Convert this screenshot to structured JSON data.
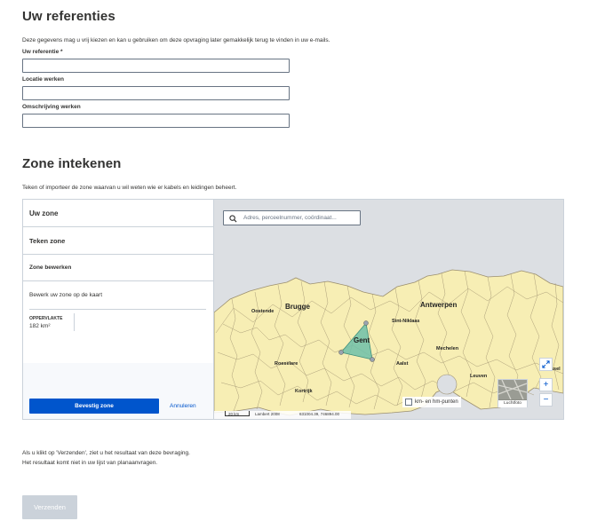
{
  "references": {
    "title": "Uw referenties",
    "intro": "Deze gegevens mag u vrij kiezen en kan u gebruiken om deze opvraging later gemakkelijk terug te vinden in uw e-mails.",
    "reference_label": "Uw referentie *",
    "reference_value": "",
    "location_label": "Locatie werken",
    "location_value": "",
    "description_label": "Omschrijving werken",
    "description_value": ""
  },
  "zone": {
    "title": "Zone intekenen",
    "intro": "Teken of importeer de zone waarvan u wil weten wie er kabels en leidingen beheert.",
    "your_zone": "Uw zone",
    "draw_zone": "Teken zone",
    "edit_zone": "Zone bewerken",
    "edit_hint": "Bewerk uw zone op de kaart",
    "area_label": "OPPERVLAKTE",
    "area_value": "182 km²",
    "confirm_button": "Bevestig zone",
    "cancel_link": "Annuleren"
  },
  "map": {
    "search_placeholder": "Adres, perceelnummer, coördinaat...",
    "places": [
      "Brugge",
      "Antwerpen",
      "Oostende",
      "Sint-Niklaas",
      "Gent",
      "Mechelen",
      "Roeselare",
      "Aalst",
      "Leuven",
      "Kortrijk",
      "ssel"
    ],
    "km_checkbox_label": "km- en hm-punten",
    "aerial_label": "Luchtfoto",
    "scale_label": "20 km",
    "projection_label": "Lambert 2008",
    "coordinate_readout": "631004.39, 746894.00",
    "colors": {
      "land": "#f7eeb4",
      "border": "#9b8f6f",
      "zone_fill": "#6fbfa9",
      "sea": "#dcdfe3"
    }
  },
  "footer": {
    "note_line1": "Als u klikt op 'Verzenden', ziet u het resultaat van deze bevraging.",
    "note_line2": "Het resultaat komt niet in uw lijst van planaanvragen.",
    "submit_button": "Verzenden"
  }
}
